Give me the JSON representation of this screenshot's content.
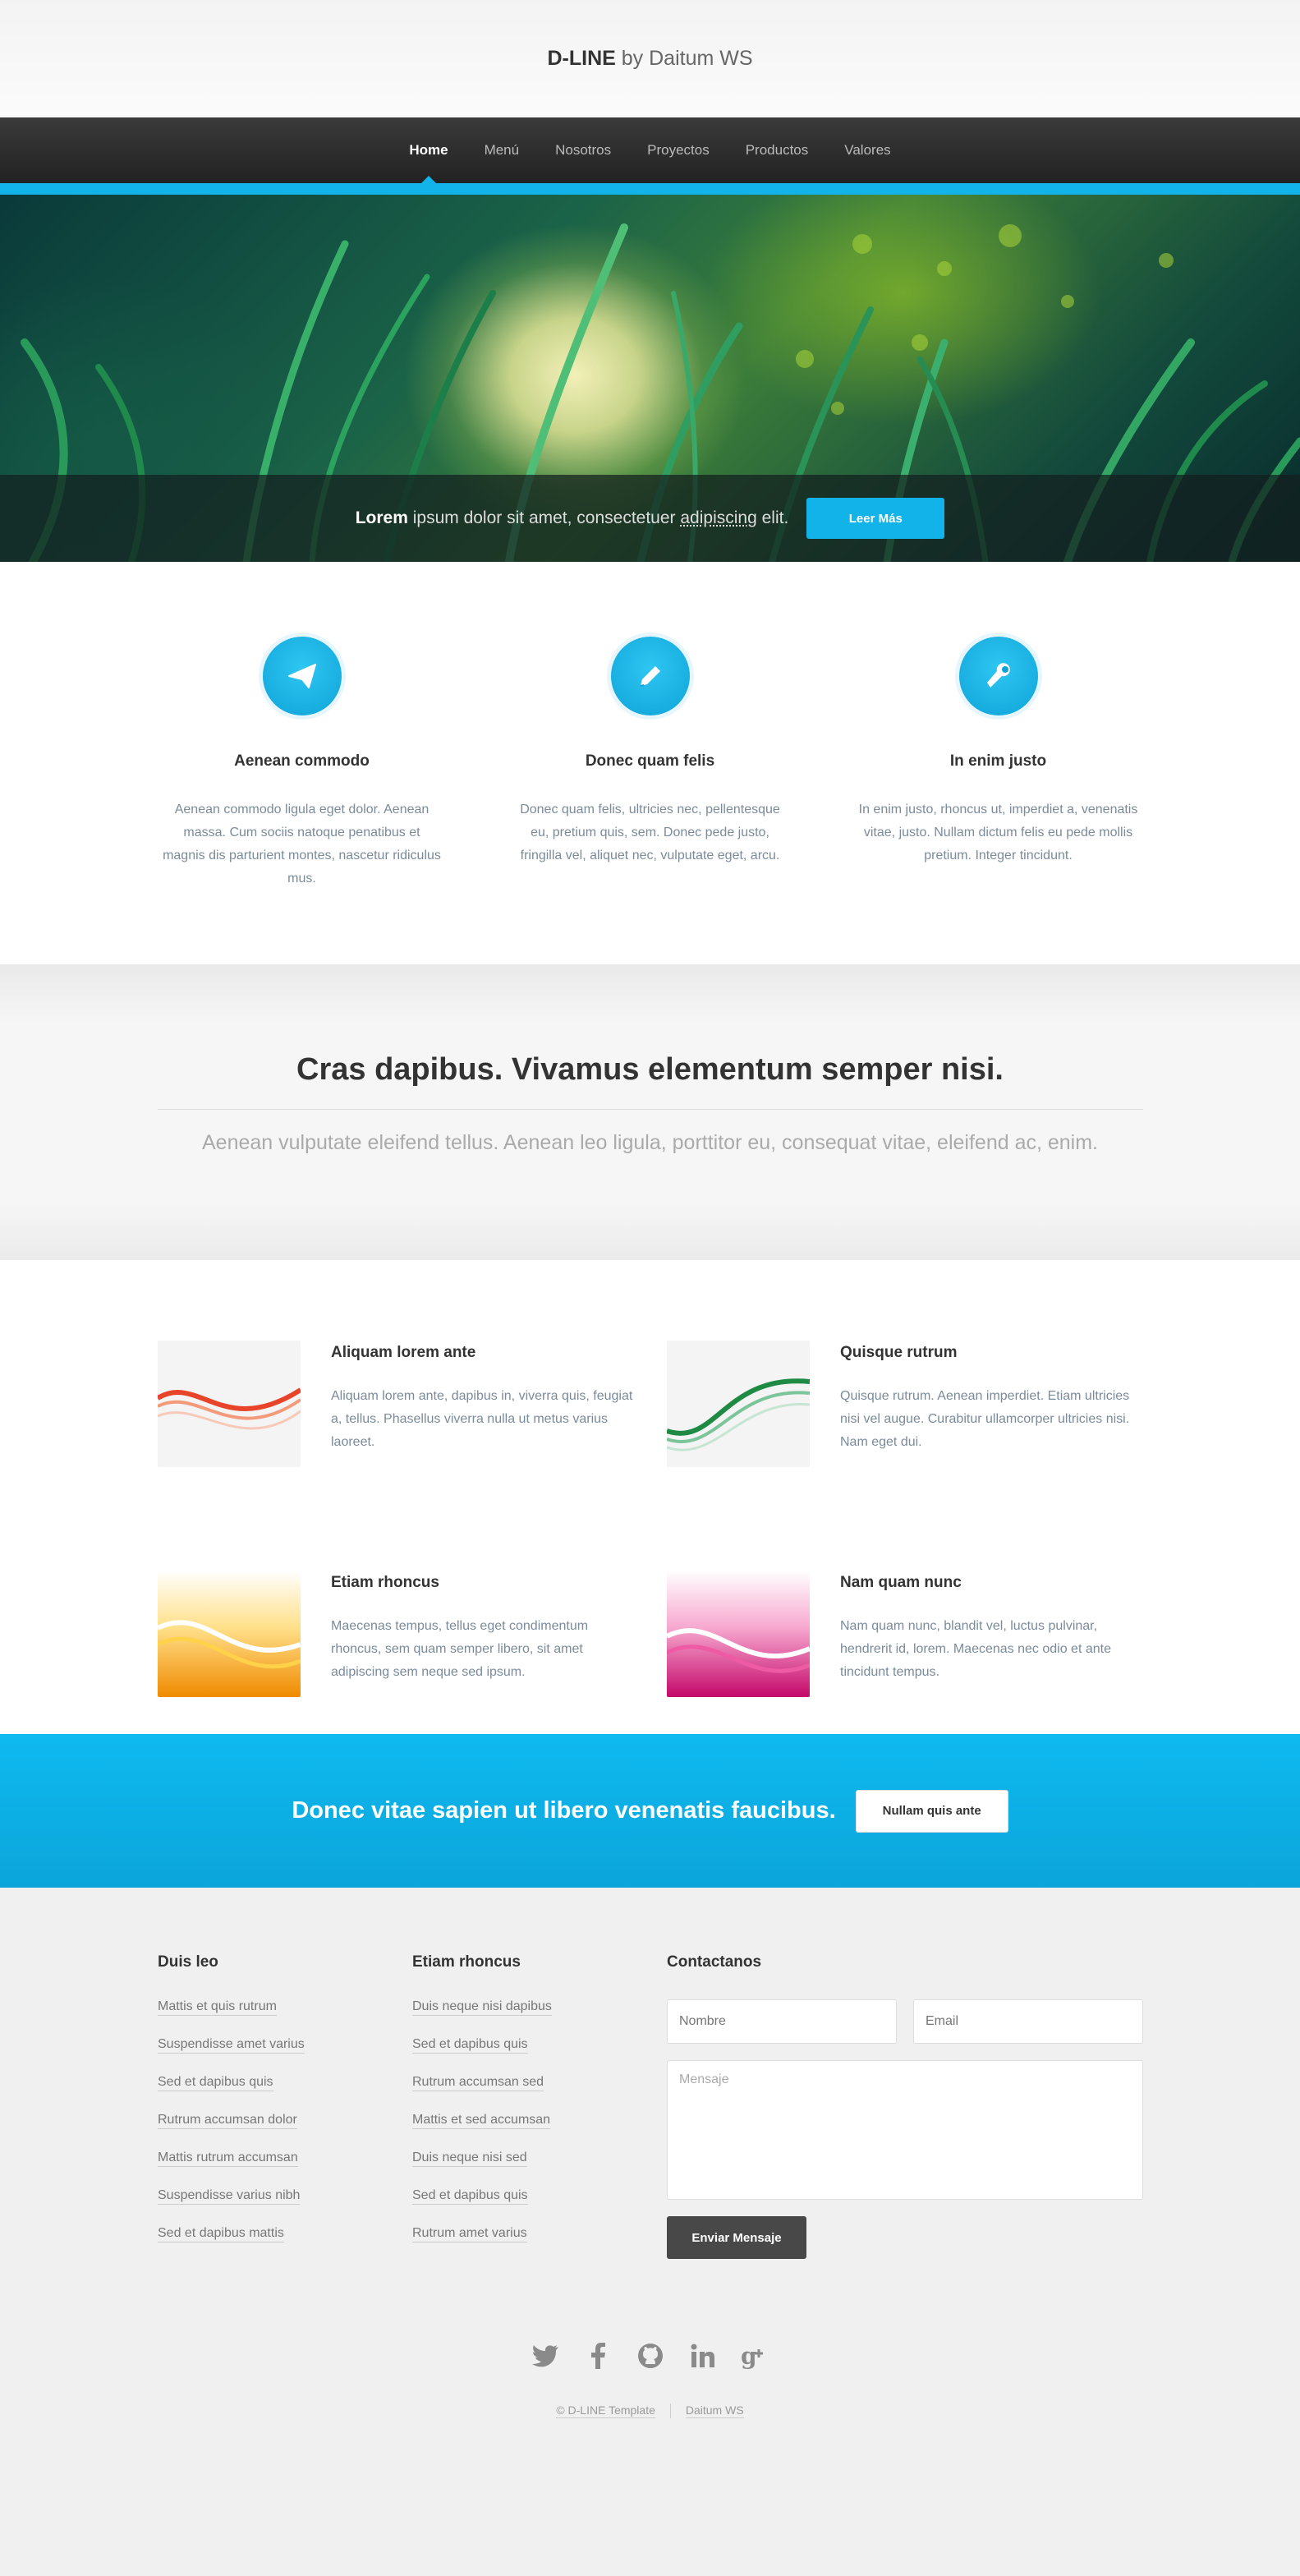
{
  "header": {
    "brand_bold": "D-LINE",
    "brand_rest": " by Daitum WS"
  },
  "nav": {
    "items": [
      "Home",
      "Menú",
      "Nosotros",
      "Proyectos",
      "Productos",
      "Valores"
    ],
    "active": "Home"
  },
  "hero": {
    "lead_bold": "Lorem",
    "lead_text": " ipsum dolor sit amet, consectetuer ",
    "lead_link": "adipiscing",
    "lead_end": " elit.",
    "button": "Leer Más"
  },
  "features": [
    {
      "icon": "paper-plane-icon",
      "title": "Aenean commodo",
      "text": "Aenean commodo ligula eget dolor. Aenean massa. Cum sociis natoque penatibus et magnis dis parturient montes, nascetur ridiculus mus."
    },
    {
      "icon": "pencil-icon",
      "title": "Donec quam felis",
      "text": "Donec quam felis, ultricies nec, pellentesque eu, pretium quis, sem. Donec pede justo, fringilla vel, aliquet nec, vulputate eget, arcu."
    },
    {
      "icon": "wrench-icon",
      "title": "In enim justo",
      "text": "In enim justo, rhoncus ut, imperdiet a, venenatis vitae, justo. Nullam dictum felis eu pede mollis pretium. Integer tincidunt."
    }
  ],
  "tagline": {
    "title": "Cras dapibus. Vivamus elementum semper nisi.",
    "subtitle": "Aenean vulputate eleifend tellus. Aenean leo ligula, porttitor eu, consequat vitae, eleifend ac, enim."
  },
  "services": [
    {
      "title": "Aliquam lorem ante",
      "text": "Aliquam lorem ante, dapibus in, viverra quis, feugiat a, tellus. Phasellus viverra nulla ut metus varius laoreet.",
      "color": "#e8442a"
    },
    {
      "title": "Quisque rutrum",
      "text": "Quisque rutrum. Aenean imperdiet. Etiam ultricies nisi vel augue. Curabitur ullamcorper ultricies nisi. Nam eget dui.",
      "color": "#1e8a44"
    },
    {
      "title": "Etiam rhoncus",
      "text": "Maecenas tempus, tellus eget condimentum rhoncus, sem quam semper libero, sit amet adipiscing sem neque sed ipsum.",
      "color": "#f5a00f"
    },
    {
      "title": "Nam quam nunc",
      "text": "Nam quam nunc, blandit vel, luctus pulvinar, hendrerit id, lorem. Maecenas nec odio et ante tincidunt tempus.",
      "color": "#d4147a"
    }
  ],
  "cta": {
    "text": "Donec vitae sapien ut libero venenatis faucibus.",
    "button": "Nullam quis ante"
  },
  "footer": {
    "col1": {
      "title": "Duis leo",
      "links": [
        "Mattis et quis rutrum",
        "Suspendisse amet varius",
        "Sed et dapibus quis",
        "Rutrum accumsan dolor",
        "Mattis rutrum accumsan",
        "Suspendisse varius nibh",
        "Sed et dapibus mattis"
      ]
    },
    "col2": {
      "title": "Etiam rhoncus",
      "links": [
        "Duis neque nisi dapibus",
        "Sed et dapibus quis",
        "Rutrum accumsan sed",
        "Mattis et sed accumsan",
        "Duis neque nisi sed",
        "Sed et dapibus quis",
        "Rutrum amet varius"
      ]
    },
    "contact": {
      "title": "Contactanos",
      "name_placeholder": "Nombre",
      "email_placeholder": "Email",
      "message_placeholder": "Mensaje",
      "button": "Enviar Mensaje"
    },
    "social": [
      "twitter-icon",
      "facebook-icon",
      "github-icon",
      "linkedin-icon",
      "google-plus-icon"
    ],
    "copyright": "© D-LINE Template",
    "credit": "Daitum WS"
  }
}
